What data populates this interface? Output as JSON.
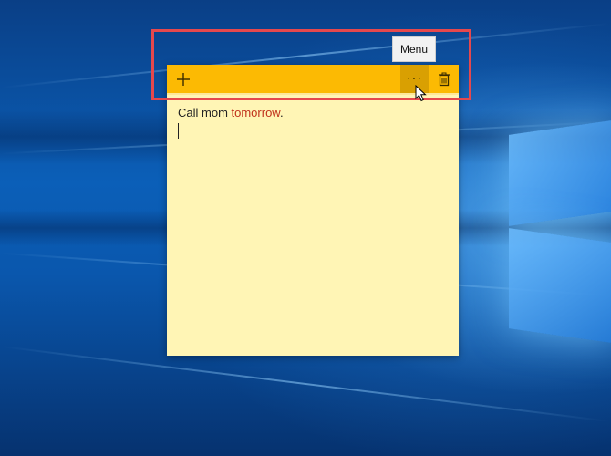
{
  "sticky_note": {
    "add_label": "Add note",
    "menu_tooltip": "Menu",
    "delete_label": "Delete note",
    "body": {
      "text_before": "Call mom ",
      "text_highlight": "tomorrow",
      "text_after": "."
    }
  },
  "colors": {
    "header": "#fcba03",
    "note_background": "#fff5b5",
    "highlight_text": "#c0311b",
    "annotation_box": "#e5484d"
  },
  "icons": {
    "add": "plus-icon",
    "menu": "more-icon",
    "delete": "trash-icon",
    "pointer": "mouse-cursor-icon"
  }
}
